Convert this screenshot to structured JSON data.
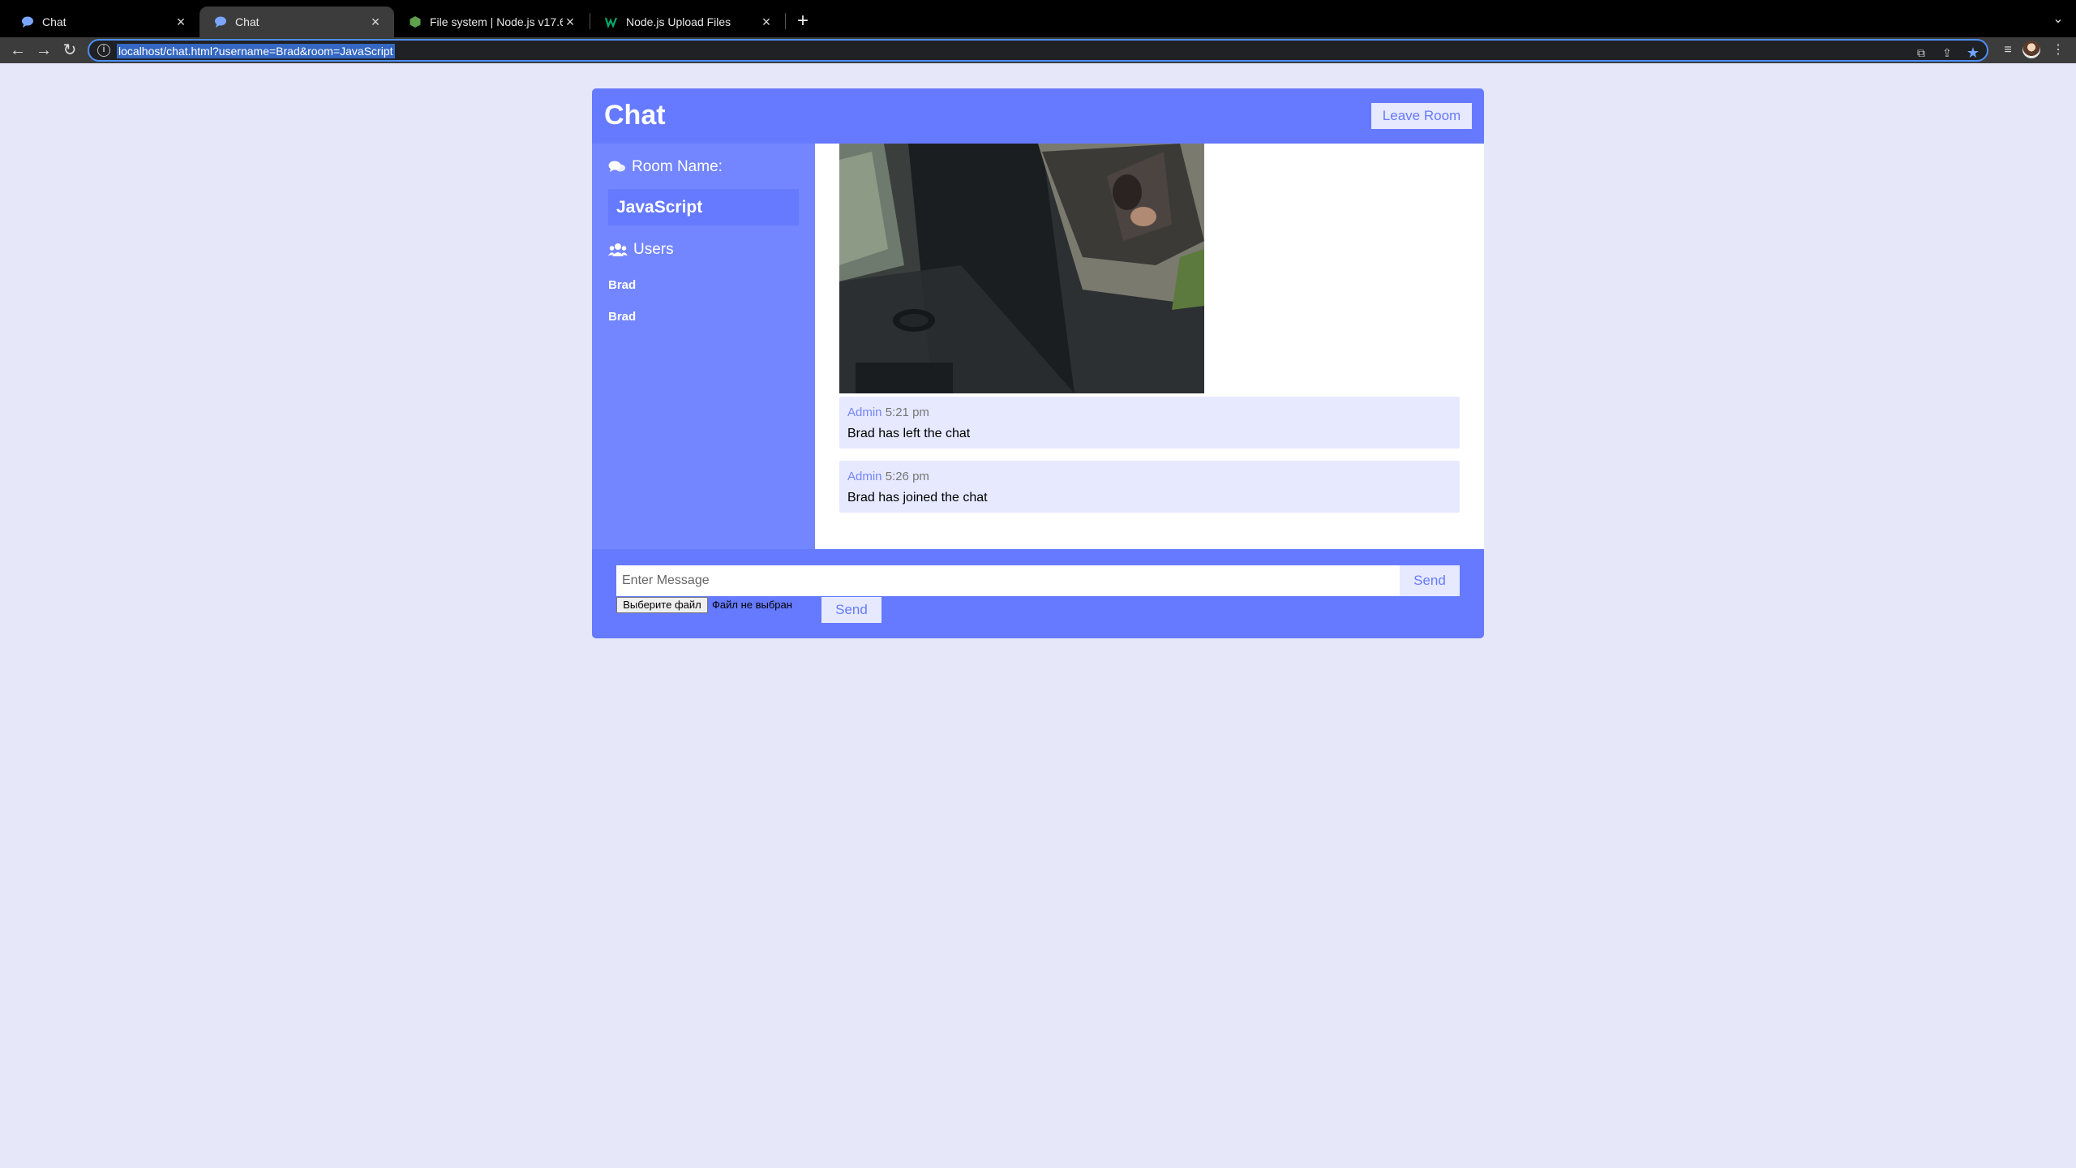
{
  "browser": {
    "tabs": [
      {
        "title": "Chat",
        "active": false
      },
      {
        "title": "Chat",
        "active": true
      },
      {
        "title": "File system | Node.js v17.6.0 D",
        "active": false
      },
      {
        "title": "Node.js Upload Files",
        "active": false
      }
    ],
    "url": "localhost/chat.html?username=Brad&room=JavaScript"
  },
  "chat": {
    "title": "Chat",
    "leave_label": "Leave Room",
    "room_heading": "Room Name:",
    "room_name": "JavaScript",
    "users_heading": "Users",
    "users": [
      "Brad",
      "Brad"
    ],
    "messages": [
      {
        "user": "Admin",
        "time": "5:21 pm",
        "text": "Brad has left the chat"
      },
      {
        "user": "Admin",
        "time": "5:26 pm",
        "text": "Brad has joined the chat"
      }
    ]
  },
  "form": {
    "placeholder": "Enter Message",
    "send_label": "Send",
    "file_button": "Выберите файл",
    "file_status": "Файл не выбран",
    "send2_label": "Send"
  },
  "colors": {
    "primary": "#667aff",
    "secondary": "#7386ff",
    "light": "#e6e9ff",
    "page_bg": "#e6e8fa"
  }
}
